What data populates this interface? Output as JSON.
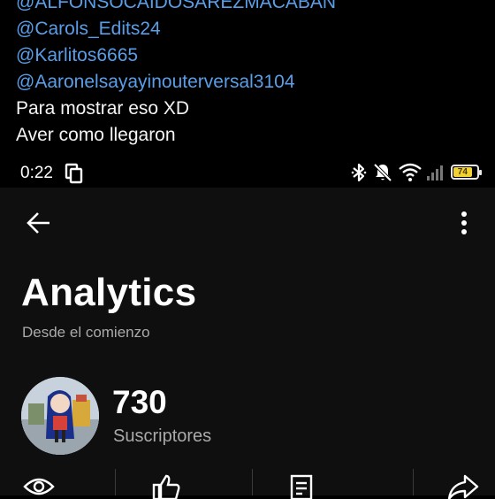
{
  "caption": {
    "cut_line": "@ALFONSOCAIDOSAREZMACABAN",
    "mentions": [
      "@Carols_Edits24",
      "@Karlitos6665",
      "@Aaronelsayayinouterversal3104"
    ],
    "lines": [
      "Para mostrar eso XD",
      "Aver como llegaron"
    ],
    "mention_color": "#5a9ee8"
  },
  "status_bar": {
    "time": "0:22",
    "battery": "74",
    "battery_color": "#f2d233",
    "icons": [
      "copy-icon",
      "bluetooth-icon",
      "mute-icon",
      "wifi-icon",
      "signal-icon",
      "battery-icon"
    ]
  },
  "header": {
    "title": "Analytics",
    "subtitle": "Desde el comienzo"
  },
  "channel": {
    "subscribers": "730",
    "subscribers_label": "Suscriptores"
  },
  "stats_icons": [
    "eye-icon",
    "thumb-up-icon",
    "comment-icon",
    "share-icon"
  ]
}
